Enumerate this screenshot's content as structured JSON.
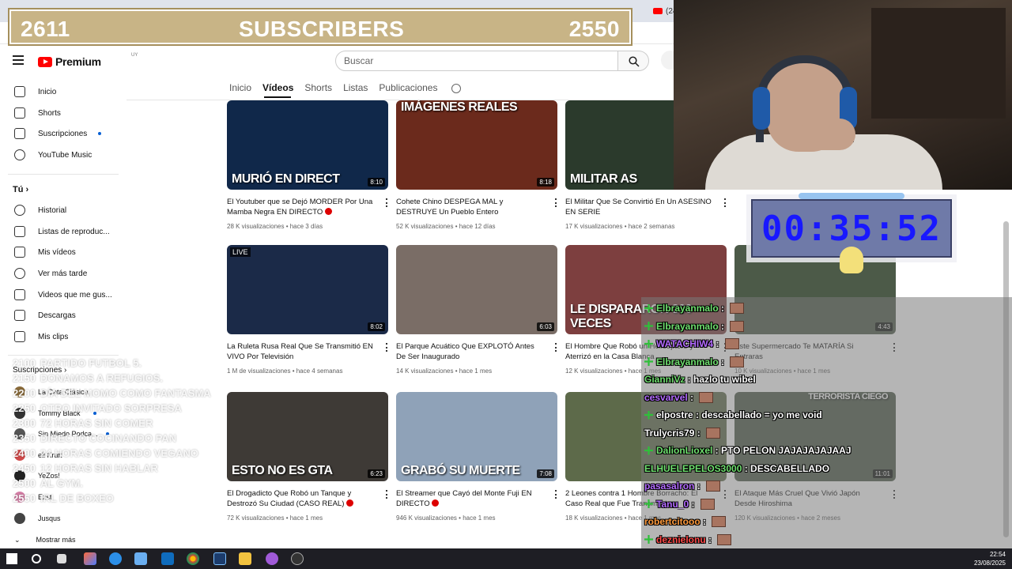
{
  "browser": {
    "tab_right_label": "(24"
  },
  "masthead": {
    "logo_text": "Premium",
    "logo_country": "UY",
    "search_placeholder": "Buscar"
  },
  "sidebar": {
    "items": [
      {
        "label": "Inicio",
        "icon": "home-icon"
      },
      {
        "label": "Shorts",
        "icon": "shorts-icon"
      },
      {
        "label": "Suscripciones",
        "icon": "subscriptions-icon"
      },
      {
        "label": "YouTube Music",
        "icon": "music-icon"
      }
    ],
    "you_heading": "Tú",
    "you_items": [
      {
        "label": "Historial",
        "icon": "history-icon"
      },
      {
        "label": "Listas de reproduc...",
        "icon": "playlists-icon"
      },
      {
        "label": "Mis vídeos",
        "icon": "my-videos-icon"
      },
      {
        "label": "Ver más tarde",
        "icon": "watch-later-icon"
      },
      {
        "label": "Videos que me gus...",
        "icon": "liked-icon"
      },
      {
        "label": "Descargas",
        "icon": "downloads-icon"
      },
      {
        "label": "Mis clips",
        "icon": "clips-icon"
      }
    ],
    "subs_heading": "Suscripciones",
    "subs": [
      {
        "label": "La Cata Clásica",
        "color": "#8a6b3a"
      },
      {
        "label": "Tommy Black",
        "color": "#333333"
      },
      {
        "label": "Sin Miedo Podca...",
        "color": "#555555"
      },
      {
        "label": "ell Kraft",
        "color": "#cf4a4a"
      },
      {
        "label": "YeZos!",
        "color": "#222222"
      },
      {
        "label": "Ezst",
        "color": "#d47fa6"
      },
      {
        "label": "Jusqus",
        "color": "#444444"
      }
    ],
    "show_more": "Mostrar más"
  },
  "channel_tabs": [
    "Inicio",
    "Vídeos",
    "Shorts",
    "Listas",
    "Publicaciones"
  ],
  "channel_tab_active": "Vídeos",
  "videos": [
    {
      "thumb_text": "MURIÓ EN DIRECT",
      "duration": "8:10",
      "title": "El Youtuber que se Dejó MORDER Por Una Mamba Negra EN DIRECTO",
      "views": "28 K visualizaciones",
      "age": "hace 3 días",
      "red_dot": true,
      "bg": "#10284a"
    },
    {
      "thumb_text": "IMÁGENES REALES",
      "duration": "8:18",
      "title": "Cohete Chino DESPEGA MAL y DESTRUYE Un Pueblo Entero",
      "views": "52 K visualizaciones",
      "age": "hace 12 días",
      "red_dot": false,
      "bg": "#6b2a1c"
    },
    {
      "thumb_text": "MILITAR    AS",
      "duration": "",
      "title": "El Militar Que Se Convirtió En Un ASESINO EN SERIE",
      "views": "17 K visualizaciones",
      "age": "hace 2 semanas",
      "red_dot": false,
      "bg": "#2b3a2c"
    },
    {
      "thumb_text": "",
      "duration": "8:02",
      "title": "La Ruleta Rusa Real Que Se Transmitió EN VIVO Por Televisión",
      "views": "1 M de visualizaciones",
      "age": "hace 4 semanas",
      "red_dot": false,
      "bg": "#1b2a48",
      "live": "LIVE"
    },
    {
      "thumb_text": "",
      "duration": "6:03",
      "title": "El Parque Acuático Que EXPLOTÓ Antes De Ser Inaugurado",
      "views": "14 K visualizaciones",
      "age": "hace 1 mes",
      "red_dot": false,
      "bg": "#7a6d66"
    },
    {
      "thumb_text": "LE DISPARARON 300 VECES",
      "duration": "",
      "title": "El Hombre Que Robó un Helicóptero y Aterrizó en la Casa Blanca",
      "views": "12 K visualizaciones",
      "age": "hace 1 mes",
      "red_dot": false,
      "bg": "#7d3f3f"
    },
    {
      "thumb_text": "ESTO NO ES GTA",
      "duration": "6:23",
      "title": "El Drogadicto Que Robó un Tanque y Destrozó Su Ciudad (CASO REAL)",
      "views": "72 K visualizaciones",
      "age": "hace 1 mes",
      "red_dot": true,
      "bg": "#3e3a36"
    },
    {
      "thumb_text": "GRABÓ SU MUERTE",
      "duration": "7:08",
      "title": "El Streamer que Cayó del Monte Fuji EN DIRECTO",
      "views": "946 K visualizaciones",
      "age": "hace 1 mes",
      "red_dot": true,
      "bg": "#8fa2b8"
    },
    {
      "thumb_text": "",
      "duration": "",
      "title": "2 Leones contra 1 Hombre Borracho: El Caso Real que Fue Transmitido",
      "views": "18 K visualizaciones",
      "age": "hace 1 mes",
      "red_dot": false,
      "bg": "#5d6a4a"
    }
  ],
  "hidden_right_videos": [
    {
      "title_fragment": "Sal",
      "title_fragment2": "Ca",
      "duration": "4:43",
      "title": "Este Supermercado Te MATARÍA Si Entraras",
      "meta": "200 K visualizaciones · hace 1 mes",
      "views": "10 K visualizaciones",
      "age": "hace 1 mes"
    },
    {
      "duration": "11:01",
      "title": "El Ataque Más Cruel Que Vivió Japón Desde Hiroshima",
      "views": "120 K visualizaciones",
      "age": "hace 2 meses",
      "thumb_text": "TERRORISTA CIEGO"
    }
  ],
  "overlay": {
    "subs_left": "2611",
    "subs_label": "SUBSCRIBERS",
    "subs_right": "2550",
    "timer": "00:35:52"
  },
  "goals": [
    {
      "amount": "2100",
      "text": "PARTIDO FUTBOL 5."
    },
    {
      "amount": "2150",
      "text": "DONAMOS A REFUGIOS."
    },
    {
      "amount": "2200",
      "text": "DÍA DEL MOMO COMO FANTASMA"
    },
    {
      "amount": "2250",
      "text": "OTRO INVITADO SORPRESA"
    },
    {
      "amount": "2300",
      "text": "72 HORAS SIN COMER"
    },
    {
      "amount": "2350",
      "text": "DIRECTO COCINANDO PAN"
    },
    {
      "amount": "2400",
      "text": "24 HORAS COMIENDO VEGANO"
    },
    {
      "amount": "2450",
      "text": "12 HORAS SIN HABLAR"
    },
    {
      "amount": "2500",
      "text": "AL GYM."
    },
    {
      "amount": "2550",
      "text": "IRL DE BOXEO"
    }
  ],
  "chat": [
    {
      "user": "Elbrayanmalo",
      "color": "#6fe06f",
      "badge": true,
      "msg": ""
    },
    {
      "user": "Elbrayanmalo",
      "color": "#6fe06f",
      "badge": true,
      "msg": ""
    },
    {
      "user": "WATACHIW4",
      "color": "#b36bff",
      "badge": true,
      "msg": ""
    },
    {
      "user": "Elbrayanmalo",
      "color": "#6fe06f",
      "badge": true,
      "msg": ""
    },
    {
      "user": "GianniVz",
      "color": "#6fe06f",
      "badge": false,
      "msg": "hazlo tu wibel"
    },
    {
      "user": "cesvarvel",
      "color": "#b36bff",
      "badge": false,
      "msg": ""
    },
    {
      "user": "elpostre",
      "color": "#ffffff",
      "badge": true,
      "msg": "descabellado = yo me void"
    },
    {
      "user": "Trulycris79",
      "color": "#ffffff",
      "badge": false,
      "msg": ""
    },
    {
      "user": "DalionLioxel",
      "color": "#6fe06f",
      "badge": true,
      "msg": "PTO PELON JAJAJAJAJAAJ"
    },
    {
      "user": "ELHUELEPELOS3000",
      "color": "#6fe06f",
      "badge": false,
      "msg": "DESCABELLADO"
    },
    {
      "user": "pasasalron",
      "color": "#b36bff",
      "badge": false,
      "msg": ""
    },
    {
      "user": "Tanu_0",
      "color": "#b36bff",
      "badge": true,
      "msg": ""
    },
    {
      "user": "robertcitooo",
      "color": "#ff9a3c",
      "badge": false,
      "msg": ""
    },
    {
      "user": "deznielonu",
      "color": "#ff4a4a",
      "badge": true,
      "msg": ""
    }
  ],
  "chat_extra": {
    "robertcitooo_top": "robertcitooo"
  },
  "clock": {
    "time": "22:54",
    "date": "23/08/2025"
  }
}
